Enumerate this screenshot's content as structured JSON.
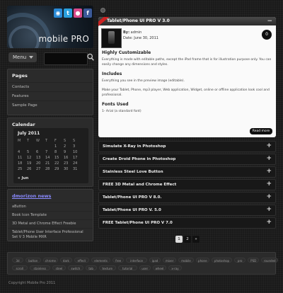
{
  "header": {
    "brand": "mobile PRO",
    "social": [
      {
        "icon": "rss-icon",
        "glyph": "◉",
        "color": "#2a8ad6"
      },
      {
        "icon": "twitter-icon",
        "glyph": "t",
        "color": "#2aa0de"
      },
      {
        "icon": "dribbble-icon",
        "glyph": "●",
        "color": "#d94a8a"
      },
      {
        "icon": "facebook-icon",
        "glyph": "f",
        "color": "#3b5998"
      }
    ]
  },
  "menubar": {
    "menu_label": "Menu",
    "search_placeholder": ""
  },
  "pages": {
    "title": "Pages",
    "items": [
      "Contacts",
      "Features",
      "Sample Page"
    ]
  },
  "calendar": {
    "title": "Calendar",
    "month": "July 2011",
    "weekdays": [
      "M",
      "T",
      "W",
      "T",
      "F",
      "S",
      "S"
    ],
    "weeks": [
      [
        "",
        "",
        "",
        "",
        "1",
        "2",
        "3"
      ],
      [
        "4",
        "5",
        "6",
        "7",
        "8",
        "9",
        "10"
      ],
      [
        "11",
        "12",
        "13",
        "14",
        "15",
        "16",
        "17"
      ],
      [
        "18",
        "19",
        "20",
        "21",
        "22",
        "23",
        "24"
      ],
      [
        "25",
        "26",
        "27",
        "28",
        "29",
        "30",
        "31"
      ]
    ],
    "prev_label": "« Jun"
  },
  "news": {
    "title": "dmorizon news",
    "items": [
      "aButton",
      "Book Icon Template",
      "3D Metal and Chrome Effect Freebie",
      "Tablet/Phone User Interface Professional Set V 3 Mobile MXR"
    ]
  },
  "post": {
    "title": "Tablet/Phone UI PRO V 3.0",
    "author_label": "By:",
    "author": "admin",
    "date_label": "Date:",
    "date": "June 30, 2011",
    "comments": "0",
    "heading1": "Highly Customizable",
    "para1": "Everything is made with editable paths, except the iPad frame that is for illustration purpose only. You can easily change any dimensions and styles.",
    "heading2": "Includes",
    "para2": "Everything you see in the preview image (editable).",
    "para3": "Make your Tablet, Phone, mp3 player, Web application, Widget, online or offline application look cool and professional.",
    "heading3": "Fonts Used",
    "para4": "1- Arial (a standard font)",
    "read_more": "Read more"
  },
  "accordion": [
    "Simulate X-Ray in Photoshop",
    "Create Droid Phone in Photoshop",
    "Stainless Steel Love Button",
    "FREE 3D Metal and Chrome Effect",
    "Tablet/Phone UI PRO V 8.0.",
    "Tablet/Phone UI PRO V. 5.0",
    "FREE Tablet/Phone UI PRO V 7.0"
  ],
  "pagination": {
    "pages": [
      "1",
      "2"
    ],
    "next": "»"
  },
  "tags": [
    [
      "3d",
      "button",
      "chrome",
      "dark",
      "effect",
      "elements",
      "free",
      "interface",
      "ipad",
      "mixer",
      "mobile",
      "phone",
      "photoshop",
      "pro",
      "PSD",
      "rounded"
    ],
    [
      "scroll",
      "stainless",
      "steel",
      "switch",
      "tab",
      "texture",
      "tutorial",
      "user",
      "wheel",
      "x-ray"
    ]
  ],
  "footer": {
    "copyright": "Copyright Mobile Pro 2011"
  },
  "colors": {
    "accent": "#c22222",
    "panel": "#2b2b2b",
    "post_bg": "#fafafa"
  }
}
